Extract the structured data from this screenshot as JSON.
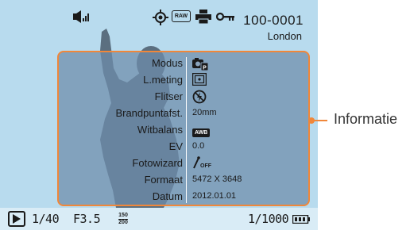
{
  "topbar": {
    "file_number": "100-0001",
    "location": "London",
    "volume_icon": "speaker-volume-icon",
    "gps_icon": "gps-target-icon",
    "raw_label": "RAW",
    "print_icon": "printer-icon",
    "protect_icon": "key-protect-icon"
  },
  "info_panel": {
    "rows": [
      {
        "label": "Modus",
        "icon": "camera-mode-icon"
      },
      {
        "label": "L.meting",
        "icon": "metering-icon"
      },
      {
        "label": "Flitser",
        "icon": "flash-off-icon"
      },
      {
        "label": "Brandpuntafst.",
        "value": "20mm"
      },
      {
        "label": "Witbalans",
        "icon": "awb-icon",
        "icon_text": "AWB"
      },
      {
        "label": "EV",
        "value": "0.0"
      },
      {
        "label": "Fotowizard",
        "icon": "photo-wizard-off-icon",
        "icon_text": "OFF"
      },
      {
        "label": "Formaat",
        "value": "5472 X 3648"
      },
      {
        "label": "Datum",
        "value": "2012.01.01"
      }
    ]
  },
  "callout": {
    "label": "Informatie"
  },
  "bottombar": {
    "shutter": "1/40",
    "aperture": "F3.5",
    "iso_top": "ISO",
    "iso_value": "200",
    "iso_mini_top": "150",
    "counter": "1/1000"
  },
  "colors": {
    "accent": "#f0873a",
    "panel": "#6e8caa",
    "screen": "#b8dbee"
  }
}
